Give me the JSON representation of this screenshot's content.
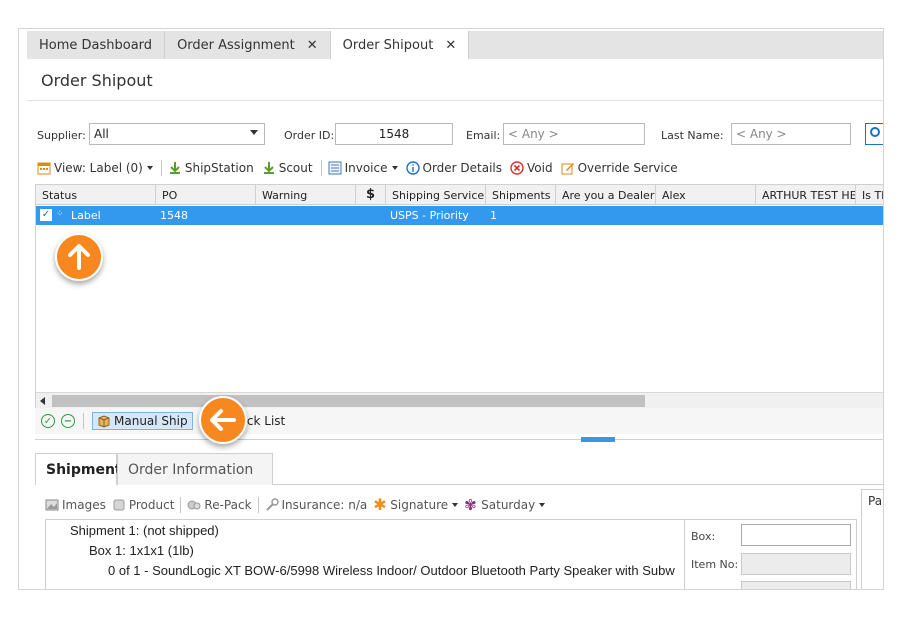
{
  "tabs": [
    {
      "label": "Home Dashboard",
      "closable": false,
      "active": false
    },
    {
      "label": "Order Assignment",
      "closable": true,
      "active": false
    },
    {
      "label": "Order Shipout",
      "closable": true,
      "active": true
    }
  ],
  "page_title": "Order Shipout",
  "filters": {
    "supplier_label": "Supplier:",
    "supplier_value": "All",
    "order_id_label": "Order ID:",
    "order_id_value": "1548",
    "email_label": "Email:",
    "email_placeholder": "< Any >",
    "last_name_label": "Last Name:",
    "last_name_placeholder": "< Any >"
  },
  "toolbar": {
    "view_label": "View: Label (0)",
    "shipstation": "ShipStation",
    "scout": "Scout",
    "invoice": "Invoice",
    "order_details": "Order Details",
    "void": "Void",
    "override_service": "Override Service"
  },
  "grid": {
    "columns": [
      "Status",
      "PO",
      "Warning",
      "",
      "Shipping Service",
      "Shipments",
      "Are you a Dealer?",
      "Alex",
      "ARTHUR TEST HE",
      "Is Th"
    ],
    "row": {
      "status": "Label",
      "po": "1548",
      "shipping_service": "USPS - Priority",
      "shipments": "1"
    }
  },
  "grid_actions": {
    "manual_ship": "Manual Ship",
    "pick_list": "Pick List"
  },
  "shipment_tabs": {
    "shipment": "Shipment",
    "order_information": "Order Information"
  },
  "shipment_toolbar": {
    "images": "Images",
    "product": "Product",
    "repack": "Re-Pack",
    "insurance": "Insurance: n/a",
    "signature": "Signature",
    "saturday": "Saturday"
  },
  "shipment_tree": {
    "shipment": "Shipment 1: (not shipped)",
    "box": "Box 1: 1x1x1 (1lb)",
    "item": "0 of 1 - SoundLogic XT BOW-6/5998 Wireless Indoor/ Outdoor Bluetooth Party Speaker with Subw"
  },
  "box_panel": {
    "box_label": "Box:",
    "item_no_label": "Item No:"
  },
  "side_panel": {
    "label": "Pa"
  },
  "colors": {
    "selection": "#3399ee",
    "callout": "#f7881f",
    "void_red": "#d9332b",
    "ok_green": "#2e9e3e"
  }
}
